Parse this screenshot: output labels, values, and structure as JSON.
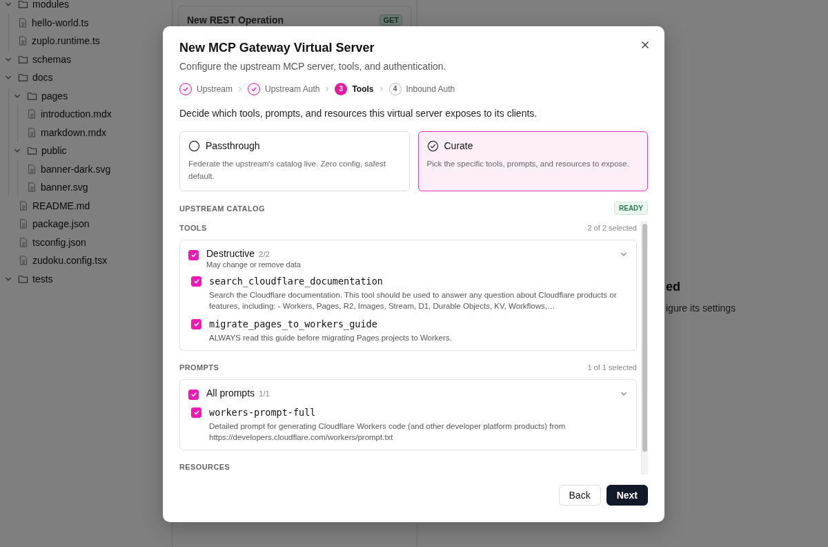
{
  "sidebar": {
    "tree": [
      {
        "kind": "folder",
        "label": "modules",
        "expanded": true,
        "children": [
          {
            "kind": "file",
            "label": "hello-world.ts"
          },
          {
            "kind": "file",
            "label": "zuplo.runtime.ts"
          }
        ]
      },
      {
        "kind": "folder",
        "label": "schemas",
        "expanded": true
      },
      {
        "kind": "folder",
        "label": "docs",
        "expanded": true,
        "children": [
          {
            "kind": "folder",
            "label": "pages",
            "expanded": true,
            "children": [
              {
                "kind": "file",
                "label": "introduction.mdx"
              },
              {
                "kind": "file",
                "label": "markdown.mdx"
              }
            ]
          },
          {
            "kind": "folder",
            "label": "public",
            "expanded": true,
            "children": [
              {
                "kind": "file",
                "label": "banner-dark.svg"
              },
              {
                "kind": "file",
                "label": "banner.svg"
              }
            ]
          }
        ]
      },
      {
        "kind": "file",
        "label": "README.md"
      },
      {
        "kind": "file",
        "label": "package.json"
      },
      {
        "kind": "file",
        "label": "tsconfig.json"
      },
      {
        "kind": "file",
        "label": "zudoku.config.tsx"
      },
      {
        "kind": "folder",
        "label": "tests",
        "expanded": true
      }
    ]
  },
  "background": {
    "card": {
      "title": "New REST Operation",
      "method": "GET"
    },
    "heading_fragment": "ed",
    "text_fragment": "igure its settings"
  },
  "dialog": {
    "title": "New MCP Gateway Virtual Server",
    "subtitle": "Configure the upstream MCP server, tools, and authentication.",
    "steps": [
      {
        "label": "Upstream",
        "completed": true,
        "selected": false
      },
      {
        "label": "Upstream Auth",
        "completed": true,
        "selected": false
      },
      {
        "label": "Tools",
        "completed": false,
        "selected": true,
        "number": "3"
      },
      {
        "label": "Inbound Auth",
        "completed": false,
        "selected": false,
        "number": "4"
      }
    ],
    "intro": "Decide which tools, prompts, and resources this virtual server exposes to its clients.",
    "options": [
      {
        "title": "Passthrough",
        "description": "Federate the upstream's catalog live. Zero config, safest default.",
        "selected": false
      },
      {
        "title": "Curate",
        "description": "Pick the specific tools, prompts, and resources to expose.",
        "selected": true
      }
    ],
    "catalog": {
      "title": "UPSTREAM CATALOG",
      "status": "READY"
    },
    "sections": [
      {
        "title": "TOOLS",
        "summary": "2 of 2 selected",
        "groups": [
          {
            "name": "Destructive",
            "count": "2/2",
            "description": "May change or remove data",
            "checked": true,
            "expanded": true,
            "items": [
              {
                "name": "search_cloudflare_documentation",
                "description": "Search the Cloudflare documentation. This tool should be used to answer any question about Cloudflare products or features, including: - Workers, Pages, R2, Images, Stream, D1, Durable Objects, KV, Workflows,…",
                "checked": true
              },
              {
                "name": "migrate_pages_to_workers_guide",
                "description": "ALWAYS read this guide before migrating Pages projects to Workers.",
                "checked": true
              }
            ]
          }
        ]
      },
      {
        "title": "PROMPTS",
        "summary": "1 of 1 selected",
        "groups": [
          {
            "name": "All prompts",
            "count": "1/1",
            "checked": true,
            "expanded": true,
            "items": [
              {
                "name": "workers-prompt-full",
                "description": "Detailed prompt for generating Cloudflare Workers code (and other developer platform products) from https://developers.cloudflare.com/workers/prompt.txt",
                "checked": true
              }
            ]
          }
        ]
      },
      {
        "title": "RESOURCES"
      }
    ],
    "buttons": {
      "back": "Back",
      "next": "Next"
    }
  }
}
